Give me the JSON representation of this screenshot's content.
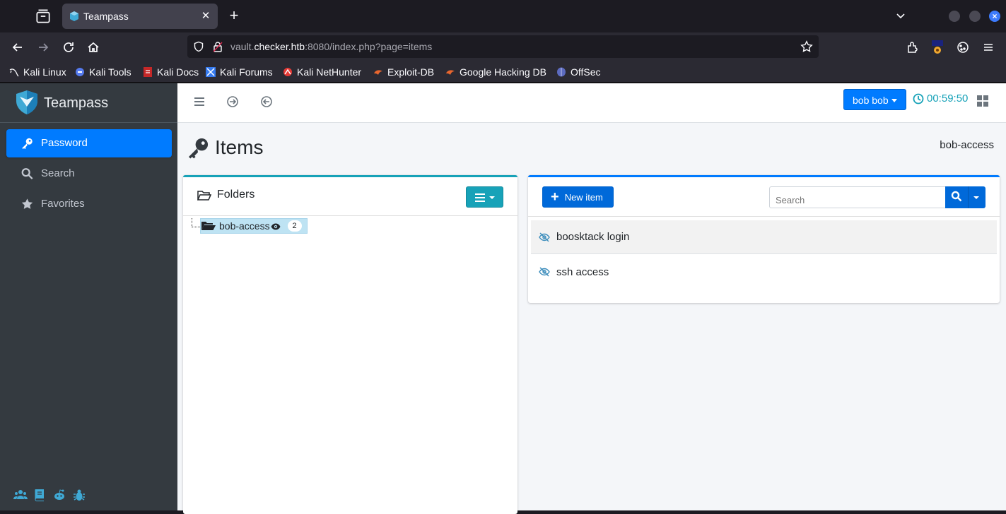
{
  "browser": {
    "tab_title": "Teampass",
    "url_prefix": "vault.",
    "url_domain": "checker.htb",
    "url_suffix": ":8080/index.php?page=items",
    "bookmarks": [
      "Kali Linux",
      "Kali Tools",
      "Kali Docs",
      "Kali Forums",
      "Kali NetHunter",
      "Exploit-DB",
      "Google Hacking DB",
      "OffSec"
    ]
  },
  "app": {
    "brand": "Teampass",
    "nav": [
      {
        "label": "Password",
        "icon": "key-icon",
        "active": true
      },
      {
        "label": "Search",
        "icon": "search-icon",
        "active": false
      },
      {
        "label": "Favorites",
        "icon": "star-icon",
        "active": false
      }
    ],
    "user_label": "bob bob",
    "timer": "00:59:50",
    "page_title": "Items",
    "breadcrumb": "bob-access",
    "folders": {
      "title": "Folders",
      "tree": [
        {
          "label": "bob-access",
          "count": "2"
        }
      ]
    },
    "items": {
      "new_label": "New item",
      "search_placeholder": "Search",
      "rows": [
        {
          "label": "boosktack login"
        },
        {
          "label": "ssh access"
        }
      ]
    }
  },
  "colors": {
    "primary": "#007bff",
    "info": "#17a2b8",
    "sidebar": "#343a40"
  }
}
